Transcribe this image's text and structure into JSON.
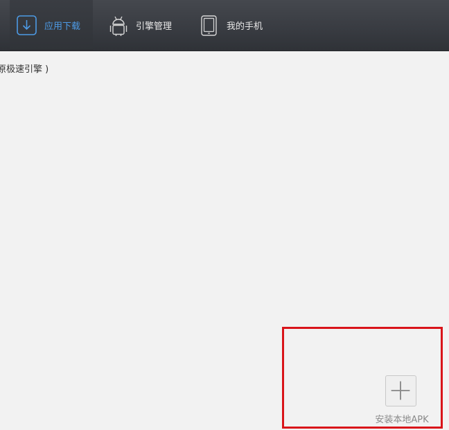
{
  "nav": {
    "tabs": [
      {
        "label": "应用下载",
        "icon": "download-icon",
        "active": true
      },
      {
        "label": "引擎管理",
        "icon": "android-icon",
        "active": false
      },
      {
        "label": "我的手机",
        "icon": "phone-icon",
        "active": false
      }
    ]
  },
  "content": {
    "status_text": "原极速引擎 )"
  },
  "install": {
    "label": "安装本地APK",
    "icon": "plus-icon"
  },
  "colors": {
    "accent": "#4d9be6",
    "highlight": "#d9141a",
    "topbar": "#383b41",
    "background": "#f2f2f2"
  }
}
